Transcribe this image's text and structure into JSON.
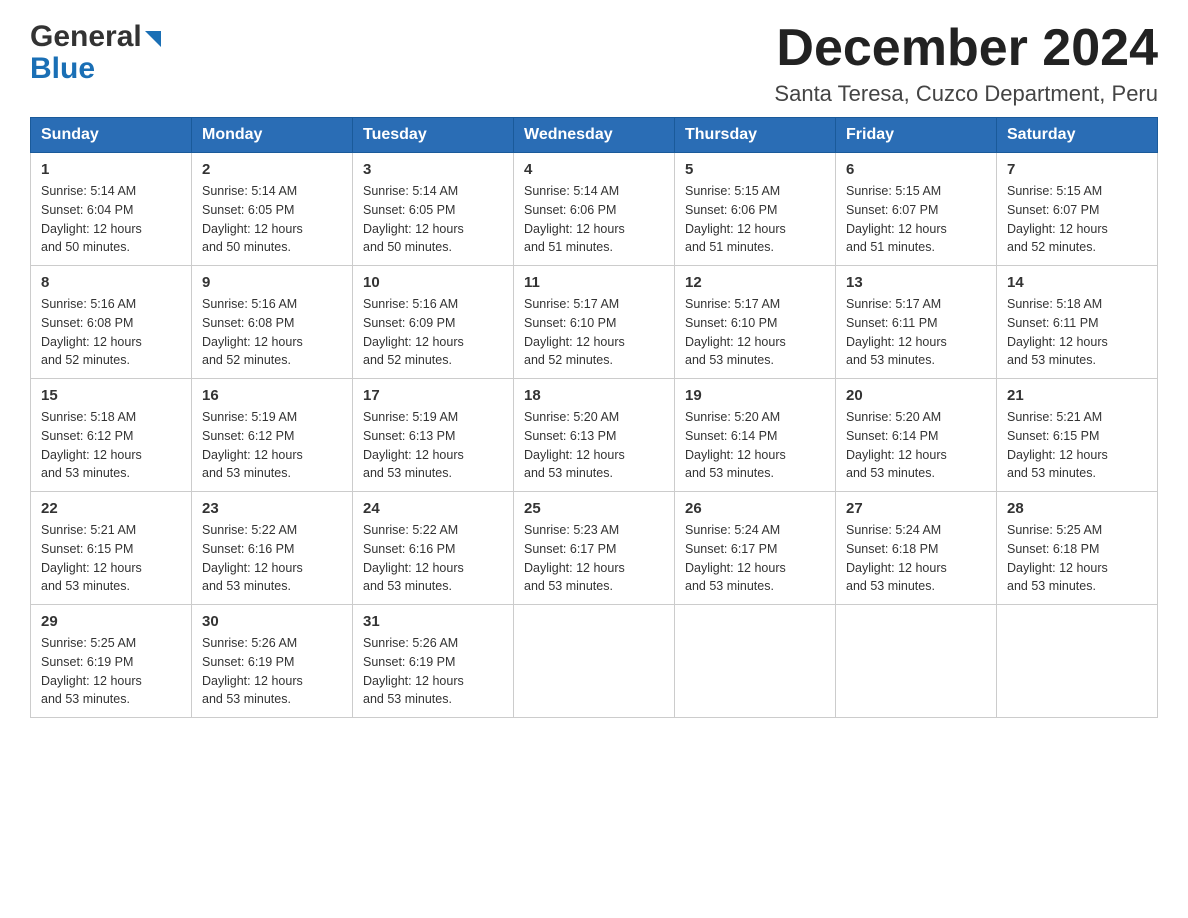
{
  "header": {
    "logo_general": "General",
    "logo_blue": "Blue",
    "month_title": "December 2024",
    "location": "Santa Teresa, Cuzco Department, Peru"
  },
  "columns": [
    "Sunday",
    "Monday",
    "Tuesday",
    "Wednesday",
    "Thursday",
    "Friday",
    "Saturday"
  ],
  "weeks": [
    [
      {
        "day": "1",
        "sunrise": "5:14 AM",
        "sunset": "6:04 PM",
        "daylight": "12 hours and 50 minutes."
      },
      {
        "day": "2",
        "sunrise": "5:14 AM",
        "sunset": "6:05 PM",
        "daylight": "12 hours and 50 minutes."
      },
      {
        "day": "3",
        "sunrise": "5:14 AM",
        "sunset": "6:05 PM",
        "daylight": "12 hours and 50 minutes."
      },
      {
        "day": "4",
        "sunrise": "5:14 AM",
        "sunset": "6:06 PM",
        "daylight": "12 hours and 51 minutes."
      },
      {
        "day": "5",
        "sunrise": "5:15 AM",
        "sunset": "6:06 PM",
        "daylight": "12 hours and 51 minutes."
      },
      {
        "day": "6",
        "sunrise": "5:15 AM",
        "sunset": "6:07 PM",
        "daylight": "12 hours and 51 minutes."
      },
      {
        "day": "7",
        "sunrise": "5:15 AM",
        "sunset": "6:07 PM",
        "daylight": "12 hours and 52 minutes."
      }
    ],
    [
      {
        "day": "8",
        "sunrise": "5:16 AM",
        "sunset": "6:08 PM",
        "daylight": "12 hours and 52 minutes."
      },
      {
        "day": "9",
        "sunrise": "5:16 AM",
        "sunset": "6:08 PM",
        "daylight": "12 hours and 52 minutes."
      },
      {
        "day": "10",
        "sunrise": "5:16 AM",
        "sunset": "6:09 PM",
        "daylight": "12 hours and 52 minutes."
      },
      {
        "day": "11",
        "sunrise": "5:17 AM",
        "sunset": "6:10 PM",
        "daylight": "12 hours and 52 minutes."
      },
      {
        "day": "12",
        "sunrise": "5:17 AM",
        "sunset": "6:10 PM",
        "daylight": "12 hours and 53 minutes."
      },
      {
        "day": "13",
        "sunrise": "5:17 AM",
        "sunset": "6:11 PM",
        "daylight": "12 hours and 53 minutes."
      },
      {
        "day": "14",
        "sunrise": "5:18 AM",
        "sunset": "6:11 PM",
        "daylight": "12 hours and 53 minutes."
      }
    ],
    [
      {
        "day": "15",
        "sunrise": "5:18 AM",
        "sunset": "6:12 PM",
        "daylight": "12 hours and 53 minutes."
      },
      {
        "day": "16",
        "sunrise": "5:19 AM",
        "sunset": "6:12 PM",
        "daylight": "12 hours and 53 minutes."
      },
      {
        "day": "17",
        "sunrise": "5:19 AM",
        "sunset": "6:13 PM",
        "daylight": "12 hours and 53 minutes."
      },
      {
        "day": "18",
        "sunrise": "5:20 AM",
        "sunset": "6:13 PM",
        "daylight": "12 hours and 53 minutes."
      },
      {
        "day": "19",
        "sunrise": "5:20 AM",
        "sunset": "6:14 PM",
        "daylight": "12 hours and 53 minutes."
      },
      {
        "day": "20",
        "sunrise": "5:20 AM",
        "sunset": "6:14 PM",
        "daylight": "12 hours and 53 minutes."
      },
      {
        "day": "21",
        "sunrise": "5:21 AM",
        "sunset": "6:15 PM",
        "daylight": "12 hours and 53 minutes."
      }
    ],
    [
      {
        "day": "22",
        "sunrise": "5:21 AM",
        "sunset": "6:15 PM",
        "daylight": "12 hours and 53 minutes."
      },
      {
        "day": "23",
        "sunrise": "5:22 AM",
        "sunset": "6:16 PM",
        "daylight": "12 hours and 53 minutes."
      },
      {
        "day": "24",
        "sunrise": "5:22 AM",
        "sunset": "6:16 PM",
        "daylight": "12 hours and 53 minutes."
      },
      {
        "day": "25",
        "sunrise": "5:23 AM",
        "sunset": "6:17 PM",
        "daylight": "12 hours and 53 minutes."
      },
      {
        "day": "26",
        "sunrise": "5:24 AM",
        "sunset": "6:17 PM",
        "daylight": "12 hours and 53 minutes."
      },
      {
        "day": "27",
        "sunrise": "5:24 AM",
        "sunset": "6:18 PM",
        "daylight": "12 hours and 53 minutes."
      },
      {
        "day": "28",
        "sunrise": "5:25 AM",
        "sunset": "6:18 PM",
        "daylight": "12 hours and 53 minutes."
      }
    ],
    [
      {
        "day": "29",
        "sunrise": "5:25 AM",
        "sunset": "6:19 PM",
        "daylight": "12 hours and 53 minutes."
      },
      {
        "day": "30",
        "sunrise": "5:26 AM",
        "sunset": "6:19 PM",
        "daylight": "12 hours and 53 minutes."
      },
      {
        "day": "31",
        "sunrise": "5:26 AM",
        "sunset": "6:19 PM",
        "daylight": "12 hours and 53 minutes."
      },
      null,
      null,
      null,
      null
    ]
  ],
  "labels": {
    "sunrise": "Sunrise:",
    "sunset": "Sunset:",
    "daylight": "Daylight:"
  }
}
